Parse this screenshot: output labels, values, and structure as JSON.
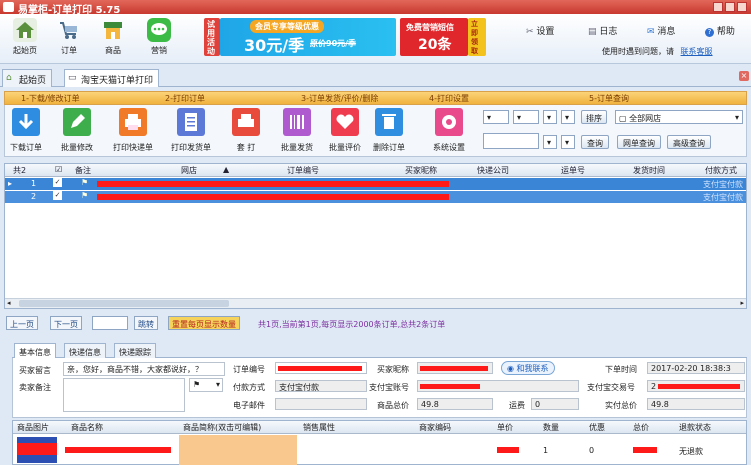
{
  "window": {
    "title": "易掌柜-订单打印 5.75"
  },
  "main_toolbar": {
    "items": [
      {
        "label": "起始页"
      },
      {
        "label": "订单"
      },
      {
        "label": "商品"
      },
      {
        "label": "营销"
      }
    ],
    "banner_side_tag": "试用活动",
    "banner_main": {
      "top": "会员专享等级优惠",
      "price": "30元/季",
      "old": "原价90元/季"
    },
    "banner_sms": {
      "top": "免费营销短信",
      "count": "20条",
      "side": "立即领取"
    },
    "right": {
      "settings": "设置",
      "log": "日志",
      "messages": "消息",
      "help": "帮助"
    },
    "hint": {
      "text": "使用时遇到问题，请",
      "link": "联系客服"
    }
  },
  "doc_tabs": [
    {
      "label": "起始页"
    },
    {
      "label": "淘宝天猫订单打印"
    }
  ],
  "steps": [
    "1-下载/修改订单",
    "2-打印订单",
    "3-订单发货/评价/删除",
    "4-打印设置",
    "5-订单查询"
  ],
  "op_toolbar": {
    "buttons": [
      "下载订单",
      "批量修改",
      "打印快递单",
      "打印发货单",
      "套 打",
      "批量发货",
      "批量评价",
      "删除订单",
      "系统设置"
    ],
    "query": {
      "sort_label": "排序",
      "shop_select": "全部网店",
      "query_btn": "查询",
      "shop_query_btn": "网单查询",
      "adv_query_btn": "高级查询"
    }
  },
  "grid": {
    "count_label": "共2",
    "columns": [
      "备注",
      "网店",
      "订单编号",
      "买家昵称",
      "快递公司",
      "运单号",
      "发货时间",
      "付款方式"
    ],
    "rows": [
      {
        "no": "1",
        "pay": "支付宝付款"
      },
      {
        "no": "2",
        "pay": "支付宝付款"
      }
    ]
  },
  "pager": {
    "prev": "上一页",
    "next": "下一页",
    "jump": "跳转",
    "reset": "重置每页显示数量",
    "info": "共1页,当前第1页,每页显示2000条订单,总共2条订单"
  },
  "detail_tabs": [
    "基本信息",
    "快递信息",
    "快递跟踪"
  ],
  "detail": {
    "buyer_msg_label": "买家留言",
    "buyer_msg": "亲，您好，商品不错，大家都说好，？",
    "seller_note_label": "卖家备注",
    "flag_value": "",
    "order_no_label": "订单编号",
    "pay_method_label": "付款方式",
    "pay_method": "支付宝付款",
    "email_label": "电子邮件",
    "buyer_nick_label": "买家昵称",
    "contact_btn": "和我联系",
    "alipay_acc_label": "支付宝账号",
    "goods_total_label": "商品总价",
    "goods_total": "49.8",
    "freight_label": "运费",
    "freight": "0",
    "order_time_label": "下单时间",
    "order_time": "2017-02-20 18:38:3",
    "alipay_trade_label": "支付宝交易号",
    "alipay_trade": "2",
    "paid_total_label": "实付总价",
    "paid_total": "49.8"
  },
  "items": {
    "columns": [
      "商品图片",
      "商品名称",
      "商品简称(双击可编辑)",
      "销售属性",
      "商家编码",
      "单价",
      "数量",
      "优惠",
      "总价",
      "退款状态"
    ],
    "row": {
      "qty": "1",
      "discount": "0",
      "refund": "无退款"
    }
  },
  "colors": {
    "titlebar": "#c8392f",
    "selection": "#3a85d6",
    "steps": "#f0b23e",
    "redact": "#ff1a1a",
    "pager_link": "#204a87"
  }
}
